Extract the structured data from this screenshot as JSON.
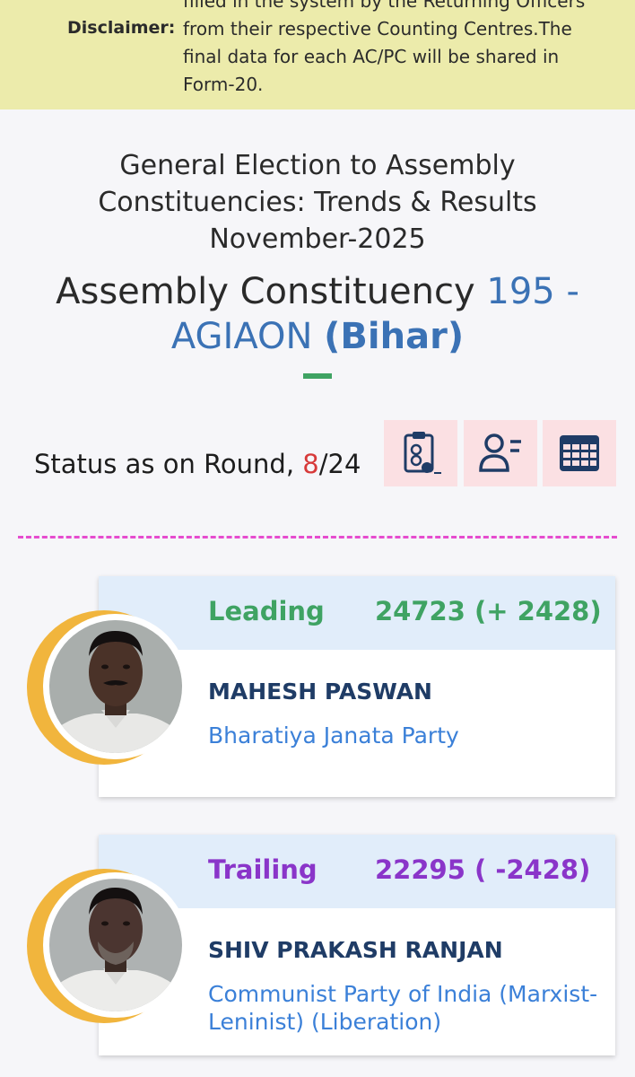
{
  "disclaimer": {
    "label": "Disclaimer:",
    "text": "filled in the system by the Returning Officers from their respective Counting Centres.The final data for each AC/PC will be shared in Form-20."
  },
  "header": {
    "title": "General Election to Assembly Constituencies: Trends & Results November-2025",
    "ac_prefix": "Assembly Constituency ",
    "ac_number_name": "195 - AGIAON",
    "state": "(Bihar)"
  },
  "status": {
    "prefix": "Status as on Round, ",
    "current_round": "8",
    "total_rounds": "/24"
  },
  "toolbar": {
    "icons": [
      "report-icon",
      "candidate-list-icon",
      "table-icon"
    ]
  },
  "candidates": [
    {
      "status": "Leading",
      "votes": "24723 (+ 2428)",
      "name": "MAHESH PASWAN",
      "party": "Bharatiya Janata Party",
      "status_color": "#3fa363"
    },
    {
      "status": "Trailing",
      "votes": "22295 ( -2428)",
      "name": "SHIV PRAKASH RANJAN",
      "party": "Communist Party of India (Marxist-Leninist) (Liberation)",
      "status_color": "#8a35c9"
    }
  ],
  "colors": {
    "disclaimer_bg": "#ecebab",
    "accent_blue": "#3b72b5",
    "round_red": "#d73a3a",
    "dashed_pink": "#e64ccf",
    "icon_bg": "#fbe0e3"
  }
}
